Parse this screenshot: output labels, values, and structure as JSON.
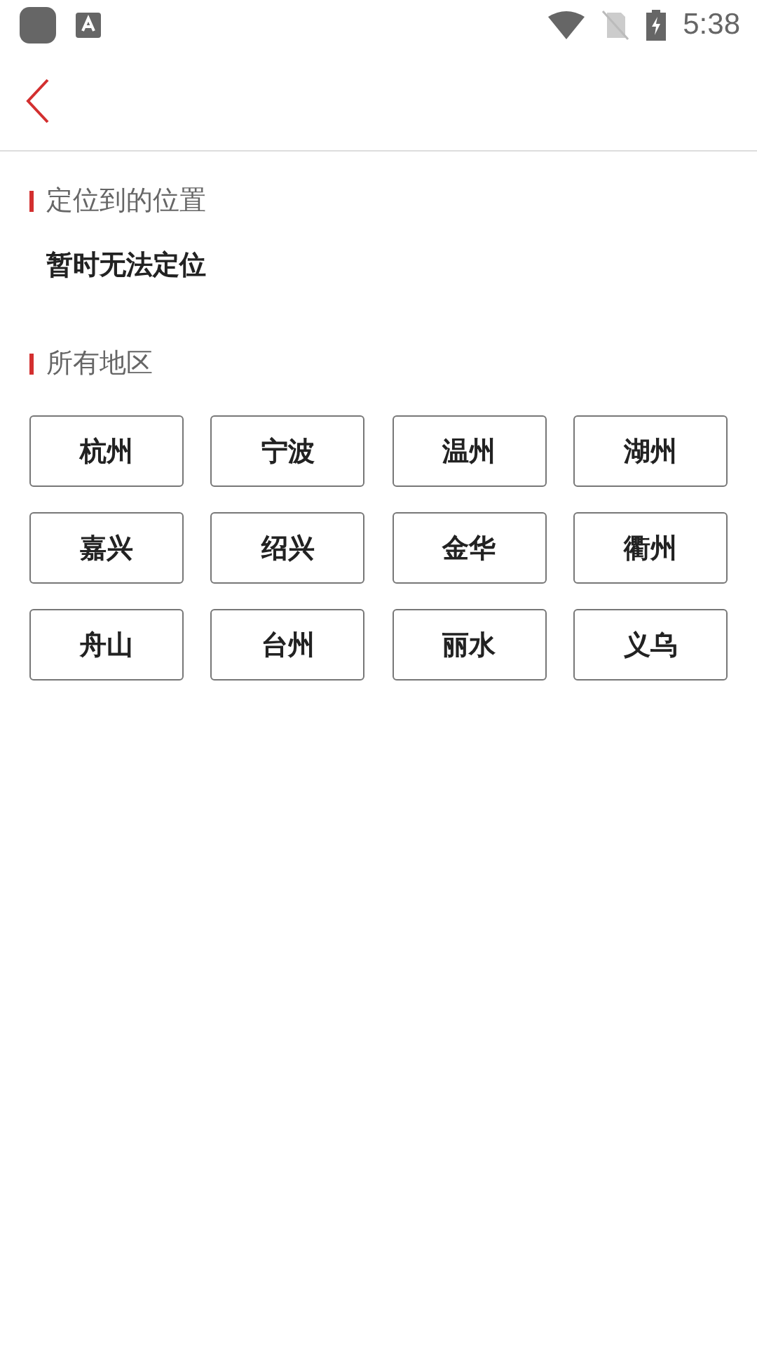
{
  "status_bar": {
    "time": "5:38"
  },
  "current_location": {
    "heading": "定位到的位置",
    "value": "暂时无法定位"
  },
  "regions": {
    "heading": "所有地区",
    "items": [
      "杭州",
      "宁波",
      "温州",
      "湖州",
      "嘉兴",
      "绍兴",
      "金华",
      "衢州",
      "舟山",
      "台州",
      "丽水",
      "义乌"
    ]
  }
}
